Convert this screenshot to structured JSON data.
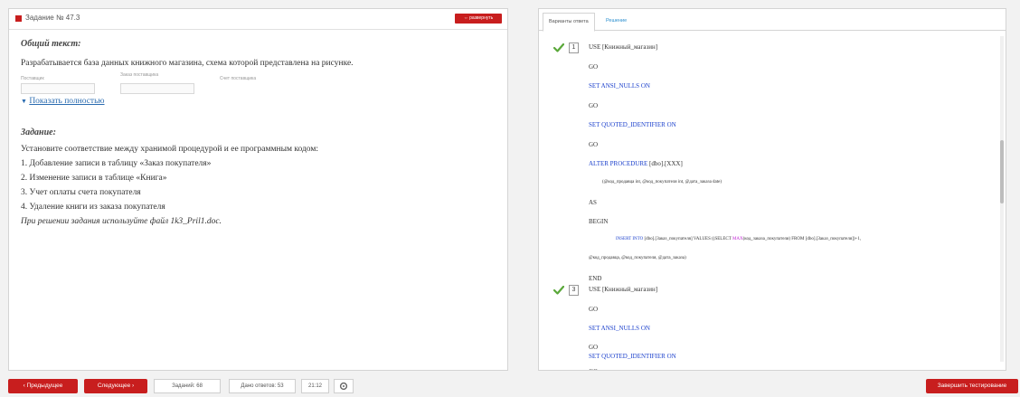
{
  "task": {
    "number": "Задание № 47.3",
    "expand_label": "⇔ развернуть",
    "general_heading": "Общий текст:",
    "description": "Разрабатывается база данных книжного магазина, схема которой представлена на рисунке.",
    "diagram_labels": [
      "Поставщик",
      "Заказ поставщика",
      "Счет поставщика"
    ],
    "show_full_label": "Показать полностью",
    "task_heading": "Задание:",
    "instruction": "Установите соответствие между хранимой процедурой и ее программным кодом:",
    "items": [
      "1. Добавление записи в таблицу «Заказ покупателя»",
      "2. Изменение записи в таблице «Книга»",
      "3. Учет оплаты счета покупателя",
      "4. Удаление книги из заказа покупателя"
    ],
    "hint": "При решении задания используйте файл 1k3_Pril1.doc."
  },
  "right": {
    "tabs": [
      "Варианты ответа",
      "Решение"
    ],
    "answer1": {
      "number": "1",
      "use_line": "USE [Книжный_магазин]",
      "go": "GO",
      "set_ansi": "SET ANSI_NULLS ON",
      "set_quoted": "SET QUOTED_IDENTIFIER ON",
      "alter_kw": "ALTER PROCEDURE",
      "alter_rest": "[dbo].[XXX]",
      "params": "(@код_продавца int, @код_покупателя int, @дата_заказа date)",
      "as": "AS",
      "begin": "BEGIN",
      "insert_kw": "INSERT INTO",
      "insert_rest": "[dbo].[Заказ_покупателя] VALUES ((SELECT",
      "insert_max": "MAX",
      "insert_tail": "(код_заказа_покупателя) FROM [dbo].[Заказ_покупателя])+1,",
      "values_line": "@код_продавца, @код_покупателя, @дата_заказа)",
      "end": "END"
    },
    "answer2": {
      "number": "3",
      "use_line": "USE [Книжный_магазин]",
      "go": "GO",
      "set_ansi": "SET ANSI_NULLS ON",
      "set_quoted": "SET QUOTED_IDENTIFIER ON"
    }
  },
  "bottom": {
    "prev": "‹ Предыдущее",
    "next": "Следующее ›",
    "tasks_count": "Заданий: 68",
    "answers_count": "Дано ответов: 53",
    "time": "21:12",
    "finish": "Завершить тестирование"
  },
  "colors": {
    "accent": "#c81e1e",
    "link": "#2b6cb0",
    "keyword": "#1a3fcc",
    "check": "#5aa83a"
  }
}
